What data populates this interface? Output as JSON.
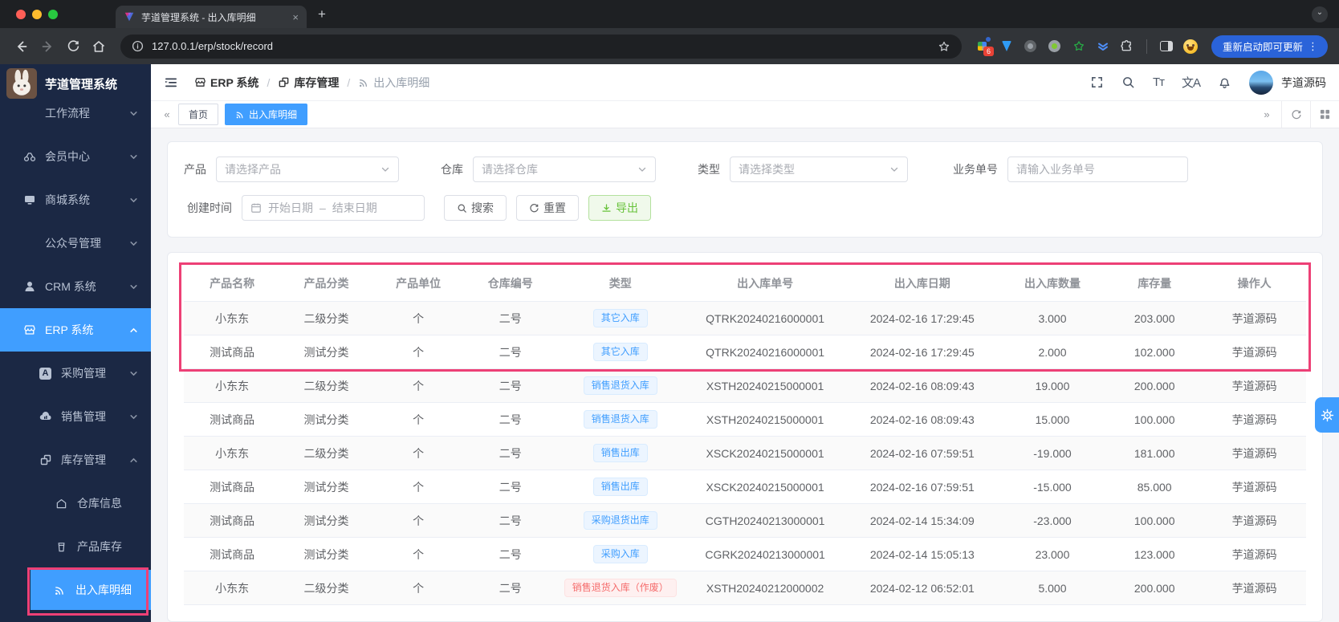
{
  "colors": {
    "primary": "#409eff",
    "success": "#67c23a",
    "danger": "#f56c6c",
    "annotation_pink": "#ed4076",
    "sidebar_bg": "#1b2844"
  },
  "browser": {
    "tab_title": "芋道管理系统 - 出入库明细",
    "url": "127.0.0.1/erp/stock/record",
    "extension_badge": "6",
    "update_button": "重新启动即可更新"
  },
  "sidebar": {
    "app_title": "芋道管理系统",
    "items": {
      "workflow": "工作流程",
      "member": "会员中心",
      "mall": "商城系统",
      "mp": "公众号管理",
      "crm": "CRM 系统",
      "erp": "ERP 系统",
      "purchase": "采购管理",
      "sales": "销售管理",
      "stock": "库存管理",
      "warehouse": "仓库信息",
      "product_stock": "产品库存",
      "stock_record": "出入库明细"
    }
  },
  "header": {
    "breadcrumb": {
      "erp": "ERP 系统",
      "stock": "库存管理",
      "record": "出入库明细"
    },
    "font_icon": "Tт",
    "locale_icon": "文A",
    "username": "芋道源码"
  },
  "tabs": {
    "home": "首页",
    "active": "出入库明细"
  },
  "filters": {
    "product_label": "产品",
    "product_placeholder": "请选择产品",
    "warehouse_label": "仓库",
    "warehouse_placeholder": "请选择仓库",
    "type_label": "类型",
    "type_placeholder": "请选择类型",
    "bizno_label": "业务单号",
    "bizno_placeholder": "请输入业务单号",
    "time_label": "创建时间",
    "date_start": "开始日期",
    "date_sep": "–",
    "date_end": "结束日期",
    "search": "搜索",
    "reset": "重置",
    "export": "导出"
  },
  "table": {
    "columns": [
      "产品名称",
      "产品分类",
      "产品单位",
      "仓库编号",
      "类型",
      "出入库单号",
      "出入库日期",
      "出入库数量",
      "库存量",
      "操作人"
    ],
    "rows": [
      {
        "product": "小东东",
        "category": "二级分类",
        "unit": "个",
        "warehouse": "二号",
        "type": "其它入库",
        "tag": "blue",
        "order": "QTRK20240216000001",
        "date": "2024-02-16 17:29:45",
        "qty": "3.000",
        "stock": "203.000",
        "operator": "芋道源码"
      },
      {
        "product": "测试商品",
        "category": "测试分类",
        "unit": "个",
        "warehouse": "二号",
        "type": "其它入库",
        "tag": "blue",
        "order": "QTRK20240216000001",
        "date": "2024-02-16 17:29:45",
        "qty": "2.000",
        "stock": "102.000",
        "operator": "芋道源码"
      },
      {
        "product": "小东东",
        "category": "二级分类",
        "unit": "个",
        "warehouse": "二号",
        "type": "销售退货入库",
        "tag": "blue",
        "order": "XSTH20240215000001",
        "date": "2024-02-16 08:09:43",
        "qty": "19.000",
        "stock": "200.000",
        "operator": "芋道源码"
      },
      {
        "product": "测试商品",
        "category": "测试分类",
        "unit": "个",
        "warehouse": "二号",
        "type": "销售退货入库",
        "tag": "blue",
        "order": "XSTH20240215000001",
        "date": "2024-02-16 08:09:43",
        "qty": "15.000",
        "stock": "100.000",
        "operator": "芋道源码"
      },
      {
        "product": "小东东",
        "category": "二级分类",
        "unit": "个",
        "warehouse": "二号",
        "type": "销售出库",
        "tag": "blue",
        "order": "XSCK20240215000001",
        "date": "2024-02-16 07:59:51",
        "qty": "-19.000",
        "stock": "181.000",
        "operator": "芋道源码"
      },
      {
        "product": "测试商品",
        "category": "测试分类",
        "unit": "个",
        "warehouse": "二号",
        "type": "销售出库",
        "tag": "blue",
        "order": "XSCK20240215000001",
        "date": "2024-02-16 07:59:51",
        "qty": "-15.000",
        "stock": "85.000",
        "operator": "芋道源码"
      },
      {
        "product": "测试商品",
        "category": "测试分类",
        "unit": "个",
        "warehouse": "二号",
        "type": "采购退货出库",
        "tag": "blue",
        "order": "CGTH20240213000001",
        "date": "2024-02-14 15:34:09",
        "qty": "-23.000",
        "stock": "100.000",
        "operator": "芋道源码"
      },
      {
        "product": "测试商品",
        "category": "测试分类",
        "unit": "个",
        "warehouse": "二号",
        "type": "采购入库",
        "tag": "blue",
        "order": "CGRK20240213000001",
        "date": "2024-02-14 15:05:13",
        "qty": "23.000",
        "stock": "123.000",
        "operator": "芋道源码"
      },
      {
        "product": "小东东",
        "category": "二级分类",
        "unit": "个",
        "warehouse": "二号",
        "type": "销售退货入库（作废）",
        "tag": "red",
        "order": "XSTH20240212000002",
        "date": "2024-02-12 06:52:01",
        "qty": "5.000",
        "stock": "200.000",
        "operator": "芋道源码"
      }
    ]
  }
}
